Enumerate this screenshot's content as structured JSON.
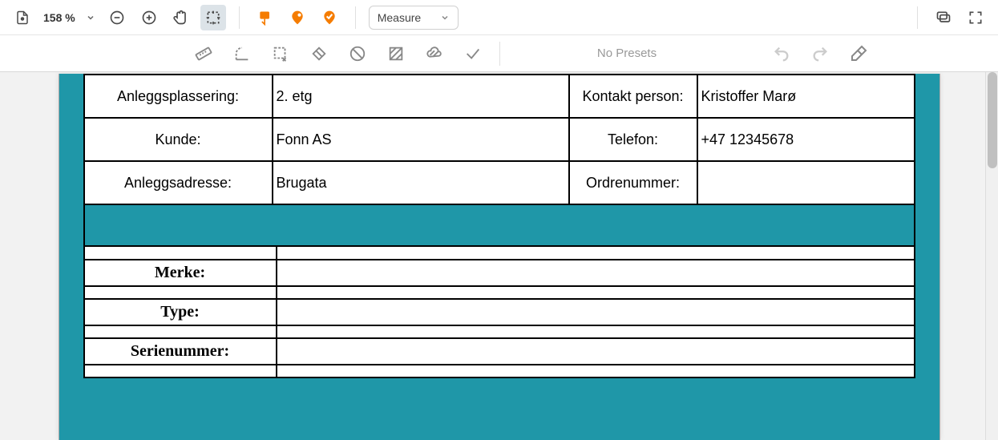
{
  "toolbar": {
    "zoom_label": "158 %",
    "measure_label": "Measure"
  },
  "subtoolbar": {
    "preset_label": "No Presets"
  },
  "form": {
    "row1": {
      "label_left": "Anleggsplassering:",
      "value_left": "2. etg",
      "label_right": "Kontakt person:",
      "value_right": "Kristoffer Marø"
    },
    "row2": {
      "label_left": "Kunde:",
      "value_left": "Fonn AS",
      "label_right": "Telefon:",
      "value_right": "+47 12345678"
    },
    "row3": {
      "label_left": "Anleggsadresse:",
      "value_left": "Brugata",
      "label_right": "Ordrenummer:",
      "value_right": ""
    }
  },
  "bottom": {
    "merke": "Merke:",
    "type": "Type:",
    "serienummer": "Serienummer:"
  }
}
